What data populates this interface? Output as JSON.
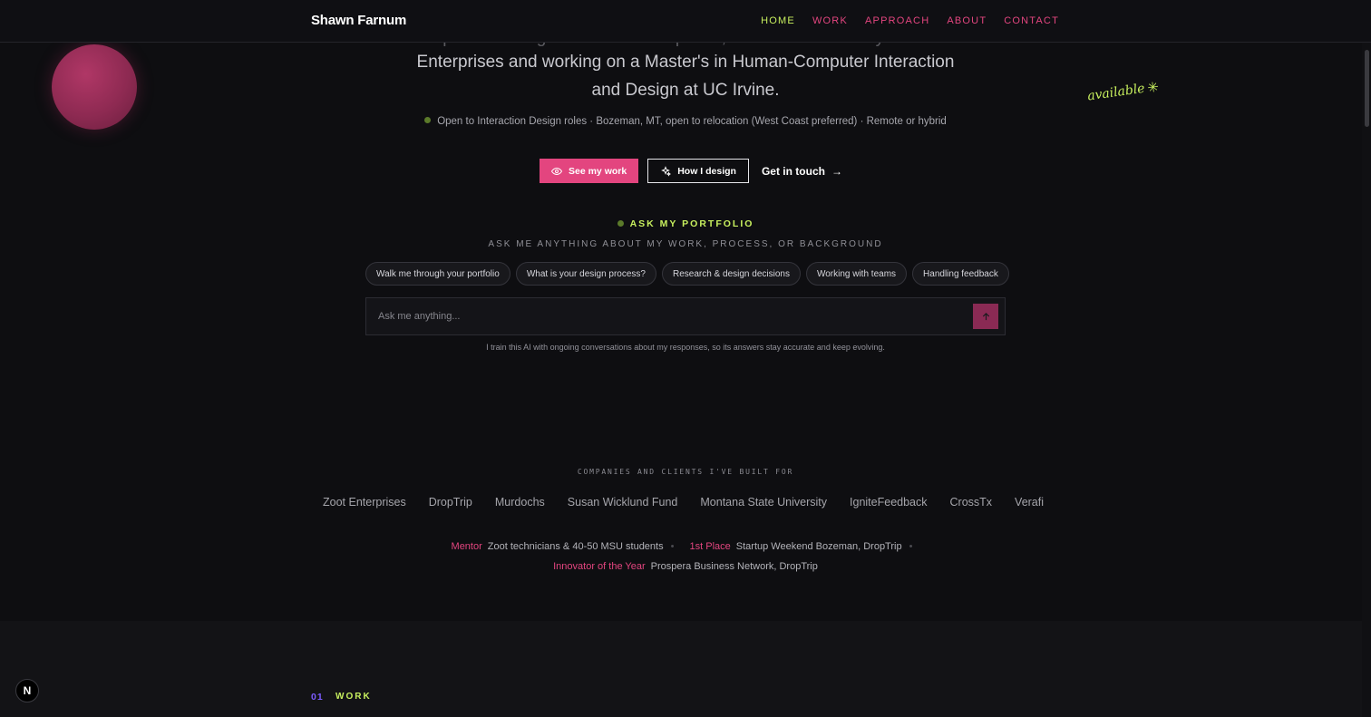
{
  "header": {
    "brand": "Shawn Farnum",
    "nav": [
      "HOME",
      "WORK",
      "APPROACH",
      "ABOUT",
      "CONTACT"
    ],
    "active_nav": "HOME"
  },
  "hero": {
    "line_clipped": "a product designer at Zoot Enterprises, focused on and way to Zoot",
    "line1": "Enterprises and working on a Master's in Human-Computer Interaction",
    "line2": "and Design at UC Irvine.",
    "status": "Open to Interaction Design roles · Bozeman, MT, open to relocation (West Coast preferred) · Remote or hybrid",
    "available": "available",
    "available_icon": "asterisk-spark-icon"
  },
  "cta": {
    "see_work": "See my work",
    "how_design": "How I design",
    "get_in_touch": "Get in touch",
    "arrow": "→"
  },
  "ask": {
    "label": "ASK MY PORTFOLIO",
    "subtitle": "ASK ME ANYTHING ABOUT MY WORK, PROCESS, OR BACKGROUND",
    "chips": [
      "Walk me through your portfolio",
      "What is your design process?",
      "Research & design decisions",
      "Working with teams",
      "Handling feedback"
    ],
    "placeholder": "Ask me anything...",
    "note": "I train this AI with ongoing conversations about my responses, so its answers stay accurate and keep evolving."
  },
  "clients": {
    "label": "COMPANIES AND CLIENTS I'VE BUILT FOR",
    "items": [
      "Zoot Enterprises",
      "DropTrip",
      "Murdochs",
      "Susan Wicklund Fund",
      "Montana State University",
      "IgniteFeedback",
      "CrossTx",
      "Verafi"
    ]
  },
  "awards": [
    {
      "key": "Mentor",
      "value": "Zoot technicians & 40-50 MSU students"
    },
    {
      "key": "1st Place",
      "value": "Startup Weekend Bozeman, DropTrip"
    },
    {
      "key": "Innovator of the Year",
      "value": "Prospera Business Network, DropTrip"
    }
  ],
  "section": {
    "number": "01",
    "name": "WORK"
  },
  "badge": "N",
  "colors": {
    "background": "#0e0e11",
    "accent_pink": "#e3457f",
    "accent_lime": "#c7ef5e",
    "accent_purple": "#7c5cff"
  }
}
